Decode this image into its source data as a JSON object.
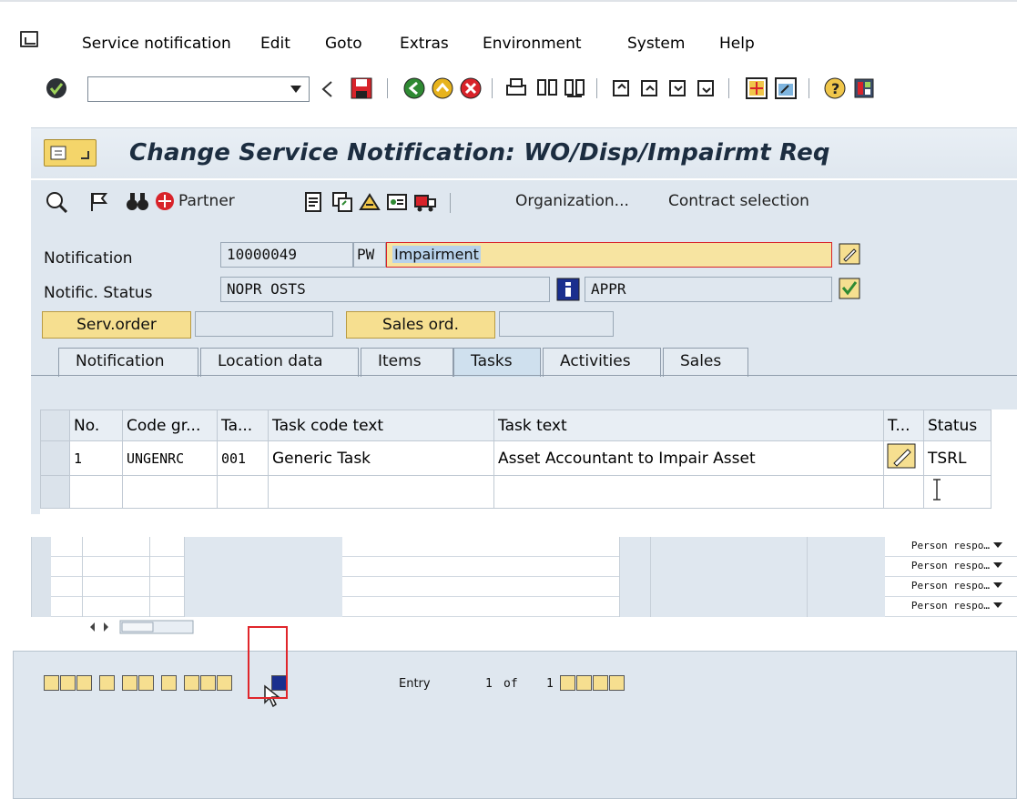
{
  "menubar": {
    "items": [
      {
        "label": "Service notification",
        "underline": "S"
      },
      {
        "label": "Edit",
        "underline": "E"
      },
      {
        "label": "Goto",
        "underline": "G"
      },
      {
        "label": "Extras",
        "underline": "x"
      },
      {
        "label": "Environment",
        "underline": "v"
      },
      {
        "label": "System",
        "underline": "y"
      },
      {
        "label": "Help",
        "underline": "H"
      }
    ]
  },
  "toolbar": {
    "command_field_value": "",
    "icons": [
      "enter-check-icon",
      "back-triangle-icon",
      "save-icon",
      "back-icon",
      "exit-icon",
      "cancel-icon",
      "print-icon",
      "find-icon",
      "find-next-icon",
      "first-page-icon",
      "previous-page-icon",
      "next-page-icon",
      "last-page-icon",
      "create-session-icon",
      "shortcut-icon",
      "help-icon",
      "customize-layout-icon"
    ]
  },
  "screen": {
    "title": "Change Service Notification: WO/Disp/Impairmt Req"
  },
  "apptoolbar": {
    "partner_label": "Partner",
    "organization_label": "Organization...",
    "contract_label": "Contract selection"
  },
  "header": {
    "notification_label": "Notification",
    "notification_number": "10000049",
    "notification_type": "PW",
    "notification_desc": "Impairment",
    "status_label": "Notific. Status",
    "status_value": "NOPR OSTS",
    "user_status": "APPR",
    "serv_order_label": "Serv.order",
    "sales_ord_label": "Sales ord."
  },
  "tabs": [
    "Notification",
    "Location data",
    "Items",
    "Tasks",
    "Activities",
    "Sales"
  ],
  "active_tab": "Tasks",
  "tasks_table": {
    "columns": [
      "No.",
      "Code gr...",
      "Ta...",
      "Task code text",
      "Task text",
      "T...",
      "Status"
    ],
    "rows": [
      {
        "no": "1",
        "code_group": "UNGENRC",
        "task": "001",
        "code_text": "Generic Task",
        "task_text": "Asset Accountant to Impair Asset",
        "status": "TSRL"
      }
    ]
  },
  "lower_table": {
    "person_responsible": "Person respo…"
  },
  "entry": {
    "label": "Entry",
    "current": "1",
    "of_label": "of",
    "total": "1"
  },
  "colors": {
    "background": "#dfe7ef",
    "highlight_yellow": "#f6df90",
    "callout_red": "#e0262b"
  }
}
